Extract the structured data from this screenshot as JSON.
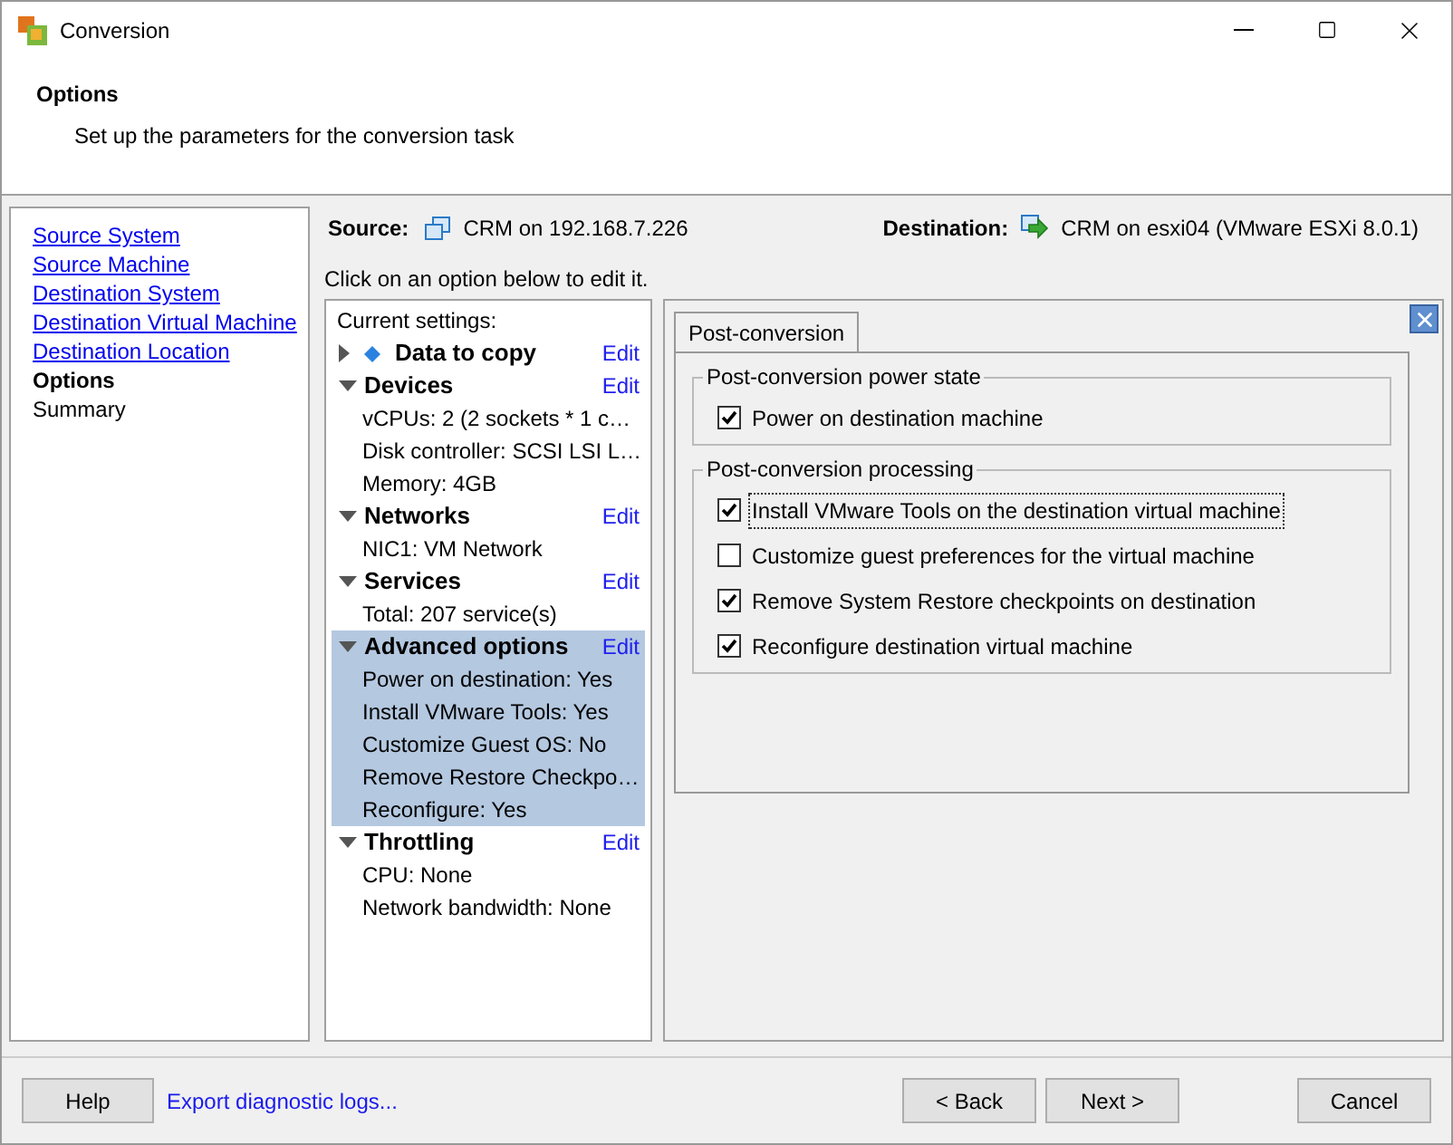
{
  "window": {
    "title": "Conversion"
  },
  "header": {
    "title": "Options",
    "subtitle": "Set up the parameters for the conversion task"
  },
  "nav": [
    {
      "label": "Source System",
      "selected": false,
      "kind": "link"
    },
    {
      "label": "Source Machine",
      "selected": false,
      "kind": "link"
    },
    {
      "label": "Destination System",
      "selected": false,
      "kind": "link"
    },
    {
      "label": "Destination Virtual Machine",
      "selected": false,
      "kind": "link"
    },
    {
      "label": "Destination Location",
      "selected": false,
      "kind": "link"
    },
    {
      "label": "Options",
      "selected": true,
      "kind": "current"
    },
    {
      "label": "Summary",
      "selected": false,
      "kind": "pending"
    }
  ],
  "source": {
    "label": "Source:",
    "value": "CRM on 192.168.7.226"
  },
  "destination": {
    "label": "Destination:",
    "value": "CRM on esxi04 (VMware ESXi 8.0.1)"
  },
  "instruction": "Click on an option below to edit it.",
  "settings": {
    "heading": "Current settings:",
    "sections": [
      {
        "title": "Data to copy",
        "edit": "Edit",
        "expanded": false,
        "selected": false
      },
      {
        "title": "Devices",
        "edit": "Edit",
        "expanded": true,
        "selected": false,
        "items": [
          "vCPUs: 2 (2 sockets * 1 c…",
          "Disk controller: SCSI LSI L…",
          "Memory: 4GB"
        ]
      },
      {
        "title": "Networks",
        "edit": "Edit",
        "expanded": true,
        "selected": false,
        "items": [
          "NIC1: VM Network"
        ]
      },
      {
        "title": "Services",
        "edit": "Edit",
        "expanded": true,
        "selected": false,
        "items": [
          "Total: 207 service(s)"
        ]
      },
      {
        "title": "Advanced options",
        "edit": "Edit",
        "expanded": true,
        "selected": true,
        "items": [
          "Power on destination: Yes",
          "Install VMware Tools: Yes",
          "Customize Guest OS: No",
          "Remove Restore Checkpo…",
          "Reconfigure: Yes"
        ]
      },
      {
        "title": "Throttling",
        "edit": "Edit",
        "expanded": true,
        "selected": false,
        "items": [
          "CPU: None",
          "Network bandwidth: None"
        ]
      }
    ]
  },
  "tab": {
    "label": "Post-conversion",
    "selected": true
  },
  "groups": [
    {
      "title": "Post-conversion power state",
      "options": [
        {
          "label": "Power on destination machine",
          "checked": true,
          "focused": false
        }
      ]
    },
    {
      "title": "Post-conversion processing",
      "options": [
        {
          "label": "Install VMware Tools on the destination virtual machine",
          "checked": true,
          "focused": true
        },
        {
          "label": "Customize guest preferences for the virtual machine",
          "checked": false,
          "focused": false
        },
        {
          "label": "Remove System Restore checkpoints on destination",
          "checked": true,
          "focused": false
        },
        {
          "label": "Reconfigure destination virtual machine",
          "checked": true,
          "focused": false
        }
      ]
    }
  ],
  "footer": {
    "help": "Help",
    "export": "Export diagnostic logs...",
    "back": "< Back",
    "next": "Next >",
    "cancel": "Cancel"
  }
}
